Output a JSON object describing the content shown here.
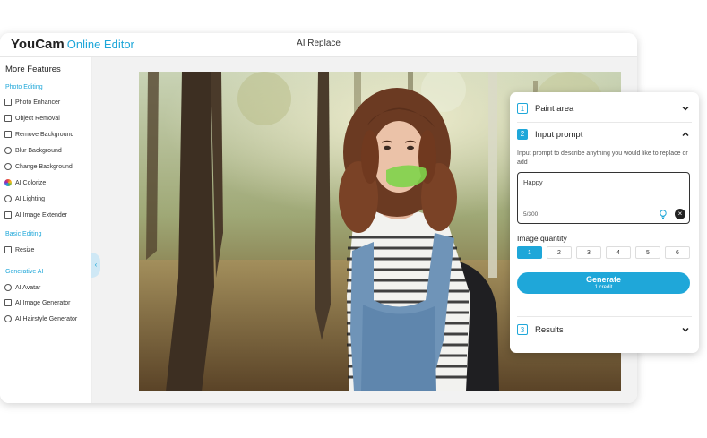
{
  "app": {
    "brand": "YouCam",
    "product": "Online Editor",
    "title": "AI Replace"
  },
  "sidebar": {
    "heading": "More Features",
    "sections": [
      {
        "title": "Photo Editing",
        "items": [
          {
            "label": "Photo Enhancer",
            "icon": "image-icon"
          },
          {
            "label": "Object Removal",
            "icon": "eraser-icon"
          },
          {
            "label": "Remove Background",
            "icon": "image-icon"
          },
          {
            "label": "Blur Background",
            "icon": "blur-icon"
          },
          {
            "label": "Change Background",
            "icon": "swap-icon"
          },
          {
            "label": "AI Colorize",
            "icon": "color-wheel-icon"
          },
          {
            "label": "AI Lighting",
            "icon": "bulb-icon"
          },
          {
            "label": "AI Image Extender",
            "icon": "expand-icon"
          }
        ]
      },
      {
        "title": "Basic Editing",
        "items": [
          {
            "label": "Resize",
            "icon": "resize-icon"
          }
        ]
      },
      {
        "title": "Generative AI",
        "items": [
          {
            "label": "AI Avatar",
            "icon": "avatar-icon"
          },
          {
            "label": "AI Image Generator",
            "icon": "image-icon"
          },
          {
            "label": "AI Hairstyle Generator",
            "icon": "hair-icon"
          }
        ]
      }
    ]
  },
  "panel": {
    "step1": {
      "num": "1",
      "label": "Paint area"
    },
    "step2": {
      "num": "2",
      "label": "Input prompt"
    },
    "description": "Input prompt to describe anything you would like to replace or add",
    "prompt": {
      "value": "Happy",
      "count": "5/300"
    },
    "quantity": {
      "label": "Image quantity",
      "options": [
        "1",
        "2",
        "3",
        "4",
        "5",
        "6"
      ],
      "selected": "1"
    },
    "generate": {
      "label": "Generate",
      "sub": "1 credit"
    },
    "step3": {
      "num": "3",
      "label": "Results"
    }
  },
  "colors": {
    "accent": "#1fa7d9",
    "mask": "#7fd44a"
  }
}
